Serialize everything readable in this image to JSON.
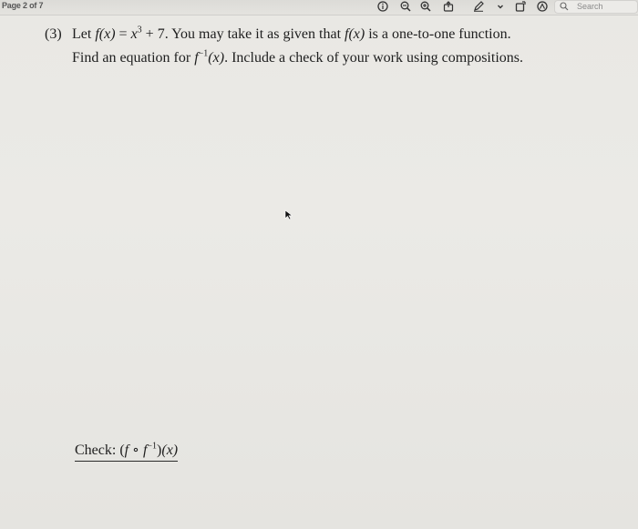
{
  "toolbar": {
    "page_indicator": "Page 2 of 7",
    "icons": [
      "info-icon",
      "zoom-out-icon",
      "zoom-in-icon",
      "share-icon",
      "markup-pen-icon",
      "chevron-down-icon",
      "window-icon",
      "markup-circle-icon",
      "search-icon"
    ],
    "search_placeholder": "Search"
  },
  "problem": {
    "number": "(3)",
    "line1": {
      "text_let": "Let ",
      "fx": "f(x)",
      "equals": " = ",
      "x": "x",
      "exp": "3",
      "plus": " + 7. You may take it as given that ",
      "fx2": "f(x)",
      "tail": " is a one-to-one function."
    },
    "line2": {
      "text_find": "Find an equation for ",
      "f": "f",
      "inv_exp": "−1",
      "arg": "(x)",
      "tail": ". Include a check of your work using compositions."
    }
  },
  "check": {
    "label": "Check: ",
    "open": "(",
    "f": "f",
    "circ": " ∘ ",
    "f2": "f",
    "inv_exp": "−1",
    "close": ")",
    "arg": "(x)"
  }
}
